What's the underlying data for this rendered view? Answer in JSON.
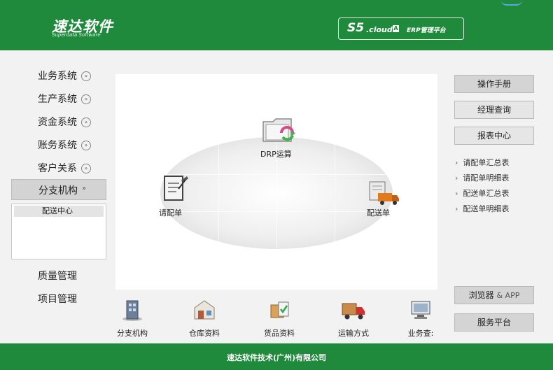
{
  "header": {
    "logo_main": "速达软件",
    "logo_sub": "Superdata Software",
    "product_s5": "S5",
    "product_cloud": ".cloud",
    "product_badge": "A",
    "product_erp": "ERP管理平台"
  },
  "sidebar": {
    "items": [
      {
        "label": "业务系统"
      },
      {
        "label": "生产系统"
      },
      {
        "label": "资金系统"
      },
      {
        "label": "账务系统"
      },
      {
        "label": "客户关系"
      }
    ],
    "active": {
      "label": "分支机构",
      "arrow": "»"
    },
    "submenu": [
      {
        "label": "配送中心"
      }
    ],
    "bottom_items": [
      {
        "label": "质量管理"
      },
      {
        "label": "项目管理"
      }
    ],
    "arrow_glyph": "»"
  },
  "diagram": {
    "nodes": [
      {
        "label": "DRP运算",
        "icon": "folder-sync-icon"
      },
      {
        "label": "请配单",
        "icon": "clipboard-pen-icon"
      },
      {
        "label": "配送单",
        "icon": "delivery-truck-icon"
      }
    ]
  },
  "right_panel": {
    "buttons": [
      {
        "label": "操作手册"
      },
      {
        "label": "经理查询"
      },
      {
        "label": "报表中心"
      }
    ],
    "reports": [
      {
        "label": "请配单汇总表"
      },
      {
        "label": "请配单明细表"
      },
      {
        "label": "配送单汇总表"
      },
      {
        "label": "配送单明细表"
      }
    ],
    "chevron": "›",
    "bottom_buttons": [
      {
        "label": "浏览器",
        "suffix": "& APP"
      },
      {
        "label": "服务平台"
      }
    ]
  },
  "toolbar": {
    "items": [
      {
        "label": "分支机构",
        "icon": "building-icon"
      },
      {
        "label": "仓库资料",
        "icon": "warehouse-icon"
      },
      {
        "label": "货品资料",
        "icon": "goods-box-icon"
      },
      {
        "label": "运输方式",
        "icon": "transport-truck-icon"
      },
      {
        "label": "业务查:",
        "icon": "monitor-search-icon"
      }
    ]
  },
  "footer": {
    "company": "速达软件技术(广州)有限公司"
  },
  "colors": {
    "brand_green": "#1f8a3c",
    "panel_bg": "#f2f2f2",
    "button_gray": "#d4d4d4"
  }
}
